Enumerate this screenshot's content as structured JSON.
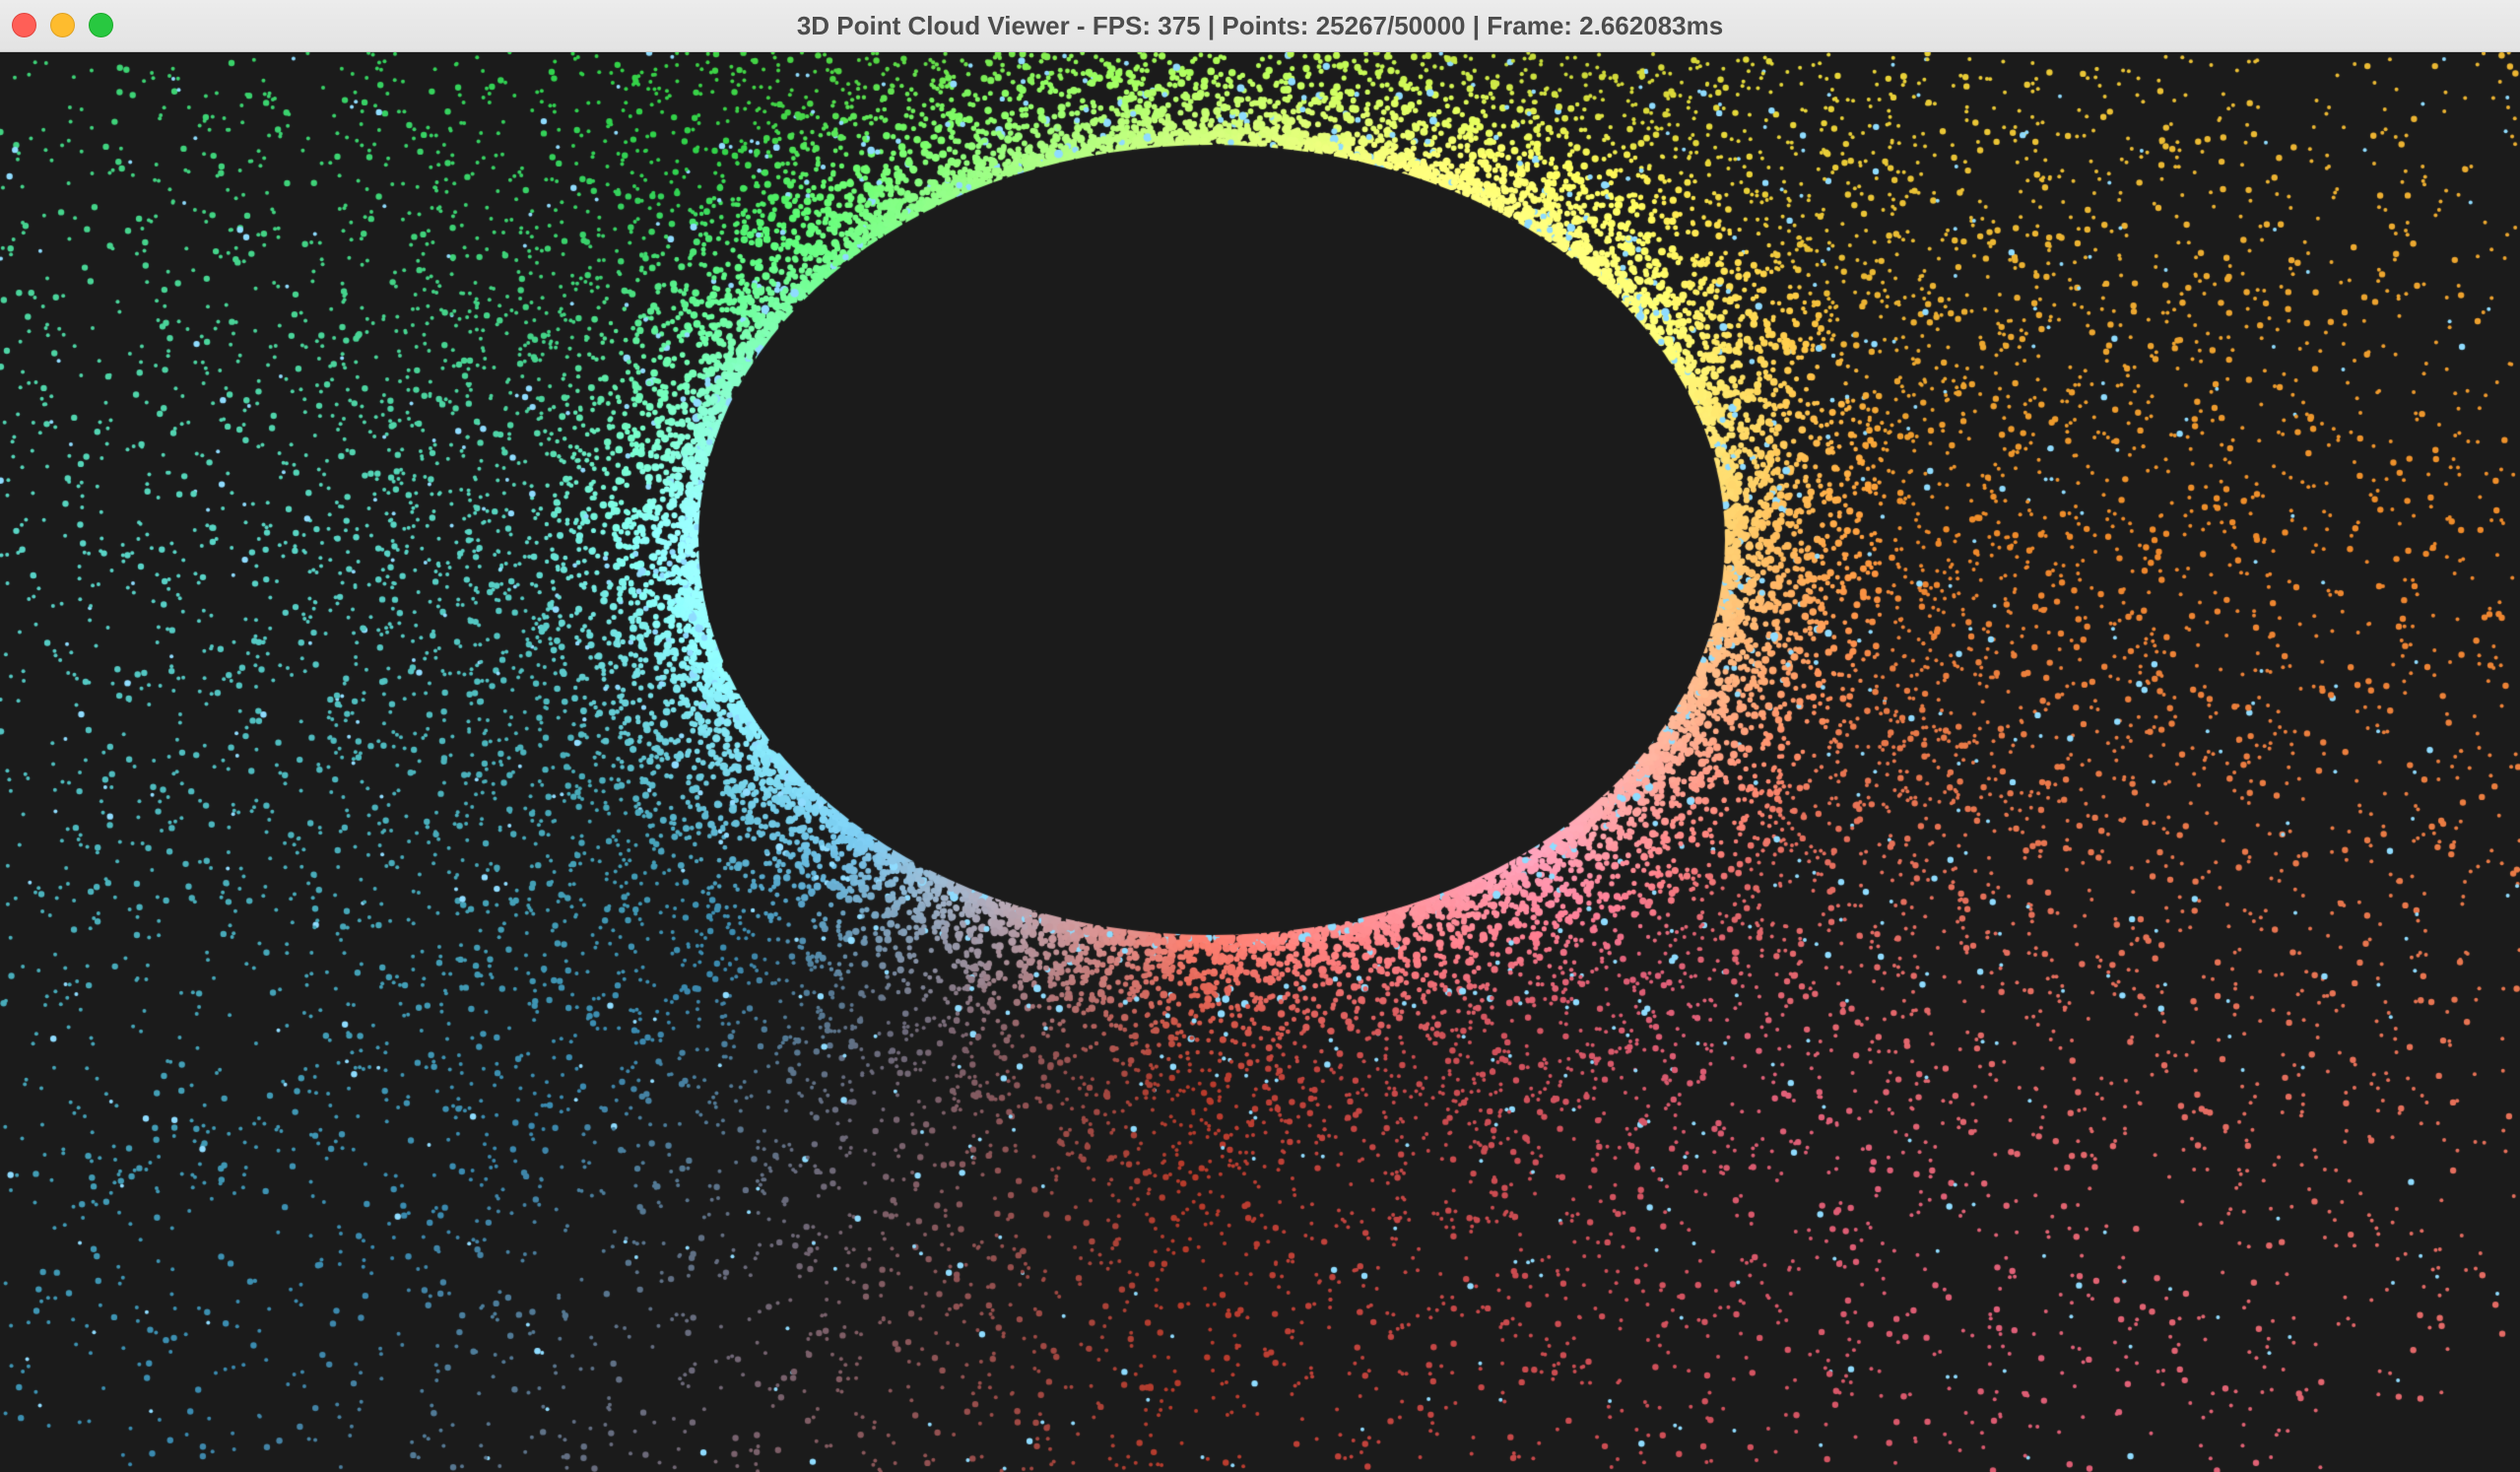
{
  "window": {
    "title": "3D Point Cloud Viewer - FPS: 375 | Points: 25267/50000 | Frame: 2.662083ms",
    "controls": [
      "close",
      "minimize",
      "zoom"
    ]
  },
  "viewer": {
    "fps": 375,
    "points_shown": 25267,
    "points_total": 50000,
    "frame_time_ms": 2.662083,
    "background_color": "#1b1b1b",
    "colors": {
      "top_left": "#2fd24a",
      "top": "#8fe03a",
      "top_right": "#e9d83a",
      "right": "#f08a2a",
      "bottom_right": "#e0607a",
      "bottom": "#b83a2a",
      "bottom_left": "#3a8ab0",
      "left": "#5ad6c8",
      "highlight": "#8fdcff"
    }
  }
}
